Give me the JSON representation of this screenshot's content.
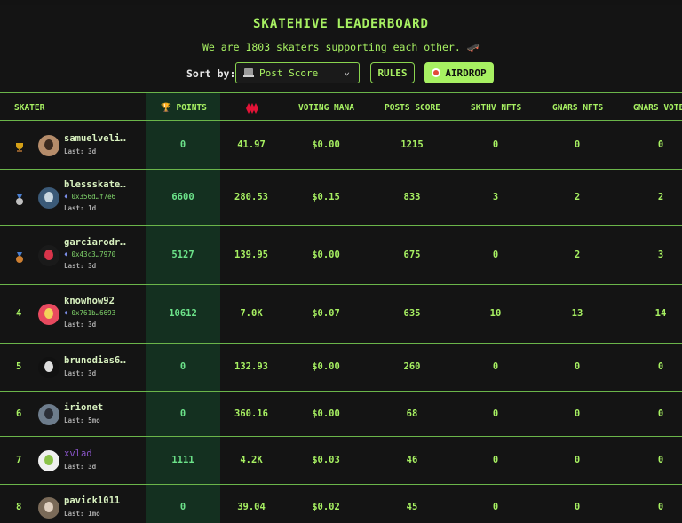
{
  "title": "SKATEHIVE LEADERBOARD",
  "subtitle": "We are 1803 skaters supporting each other. 🛹",
  "sort": {
    "label": "Sort by:",
    "selected": "Post Score"
  },
  "buttons": {
    "rules": "RULES",
    "airdrop": "AIRDROP"
  },
  "colors": {
    "accent": "#a7f062",
    "points_col": "#143020",
    "divider": "#6bb54a"
  },
  "columns": [
    "SKATER",
    "🏆 POINTS",
    "HIVE",
    "VOTING MANA",
    "POSTS SCORE",
    "SKTHV NFTS",
    "GNARS NFTS",
    "GNARS VOTE"
  ],
  "rows": [
    {
      "rank": "",
      "medal": "trophy-icon",
      "name": "samuelveli…",
      "wallet": "",
      "last": "Last: 3d",
      "points": "0",
      "hive": "41.97",
      "mana": "$0.00",
      "posts": "1215",
      "skthv": "0",
      "gnars": "0",
      "votes": "0"
    },
    {
      "rank": "",
      "medal": "silver-medal-icon",
      "name": "blessskate…",
      "wallet": "0x356d…f7e6",
      "last": "Last: 1d",
      "points": "6600",
      "hive": "280.53",
      "mana": "$0.15",
      "posts": "833",
      "skthv": "3",
      "gnars": "2",
      "votes": "2"
    },
    {
      "rank": "",
      "medal": "bronze-medal-icon",
      "name": "garciarodr…",
      "wallet": "0x43c3…7970",
      "last": "Last: 3d",
      "points": "5127",
      "hive": "139.95",
      "mana": "$0.00",
      "posts": "675",
      "skthv": "0",
      "gnars": "2",
      "votes": "3"
    },
    {
      "rank": "4",
      "medal": "",
      "name": "knowhow92",
      "wallet": "0x761b…6693",
      "last": "Last: 3d",
      "points": "10612",
      "hive": "7.0K",
      "mana": "$0.07",
      "posts": "635",
      "skthv": "10",
      "gnars": "13",
      "votes": "14"
    },
    {
      "rank": "5",
      "medal": "",
      "name": "brunodias6…",
      "wallet": "",
      "last": "Last: 3d",
      "points": "0",
      "hive": "132.93",
      "mana": "$0.00",
      "posts": "260",
      "skthv": "0",
      "gnars": "0",
      "votes": "0"
    },
    {
      "rank": "6",
      "medal": "",
      "name": "irionet",
      "wallet": "",
      "last": "Last: 5mo",
      "points": "0",
      "hive": "360.16",
      "mana": "$0.00",
      "posts": "68",
      "skthv": "0",
      "gnars": "0",
      "votes": "0"
    },
    {
      "rank": "7",
      "medal": "",
      "name": "xvlad",
      "wallet": "",
      "last": "Last: 3d",
      "points": "1111",
      "hive": "4.2K",
      "mana": "$0.03",
      "posts": "46",
      "skthv": "0",
      "gnars": "0",
      "votes": "0"
    },
    {
      "rank": "8",
      "medal": "",
      "name": "pavick1011",
      "wallet": "",
      "last": "Last: 1mo",
      "points": "0",
      "hive": "39.04",
      "mana": "$0.02",
      "posts": "45",
      "skthv": "0",
      "gnars": "0",
      "votes": "0"
    }
  ]
}
